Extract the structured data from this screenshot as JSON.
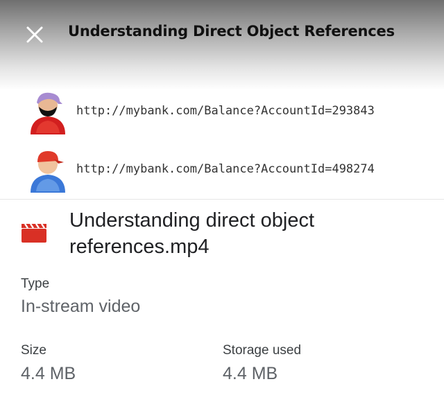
{
  "preview": {
    "title": "Understanding Direct Object References",
    "urls": [
      {
        "avatar": "pirate-user-icon",
        "text": "http://mybank.com/Balance?AccountId=293843"
      },
      {
        "avatar": "blue-user-icon",
        "text": "http://mybank.com/Balance?AccountId=498274"
      }
    ],
    "close_icon": "close-icon"
  },
  "file": {
    "icon": "video-clapper-icon",
    "icon_color": "#d93025",
    "name": "Understanding direct object references.mp4"
  },
  "details": {
    "type_label": "Type",
    "type_value": "In-stream video",
    "size_label": "Size",
    "size_value": "4.4 MB",
    "storage_label": "Storage used",
    "storage_value": "4.4 MB"
  }
}
